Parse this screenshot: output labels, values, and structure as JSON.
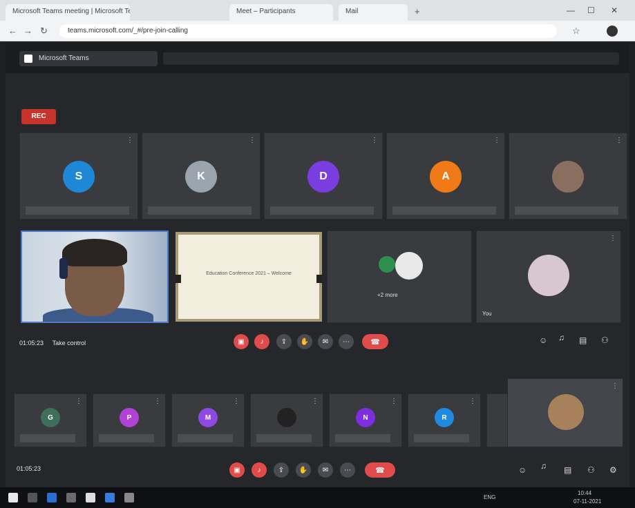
{
  "browser": {
    "tabs": [
      {
        "label": "Microsoft Teams meeting | Microsoft Teams"
      },
      {
        "label": "Meet – Participants"
      },
      {
        "label": "Mail"
      }
    ],
    "url": "teams.microsoft.com/_#/pre-join-calling"
  },
  "app": {
    "title": "Microsoft Teams",
    "recording_badge": "REC",
    "top_tiles": [
      {
        "initial": "S",
        "color": "#1e88d6",
        "menu": "⋮"
      },
      {
        "initial": "K",
        "color": "#9aa4ad",
        "menu": "⋮"
      },
      {
        "initial": "D",
        "color": "#7a3ee0",
        "menu": "⋮"
      },
      {
        "initial": "A",
        "color": "#f07a18",
        "menu": "⋮"
      },
      {
        "initial": "",
        "color": "#8a6e60",
        "menu": "⋮"
      }
    ],
    "middle_tile_group_label": "+2 more",
    "middle_tile_name": "You",
    "shared_screen_text": "Education Conference 2021 – Welcome",
    "meeting_timer_top": "01:05:23",
    "meeting_timer_top_label": "Take control",
    "bottom_tiles": [
      {
        "initial": "G",
        "color": "#3f6e5a"
      },
      {
        "initial": "P",
        "color": "#b042d6"
      },
      {
        "initial": "M",
        "color": "#8f48e0"
      },
      {
        "initial": "",
        "color": "#222222"
      },
      {
        "initial": "N",
        "color": "#7d2fe0"
      },
      {
        "initial": "R",
        "color": "#1e8ae0"
      },
      {
        "initial": "",
        "color": "#a7805c"
      }
    ],
    "meeting_timer_bottom": "01:05:23",
    "leave_label": "Leave"
  },
  "taskbar": {
    "tray_text": "ENG",
    "clock": "10:44",
    "date": "07-11-2021"
  }
}
